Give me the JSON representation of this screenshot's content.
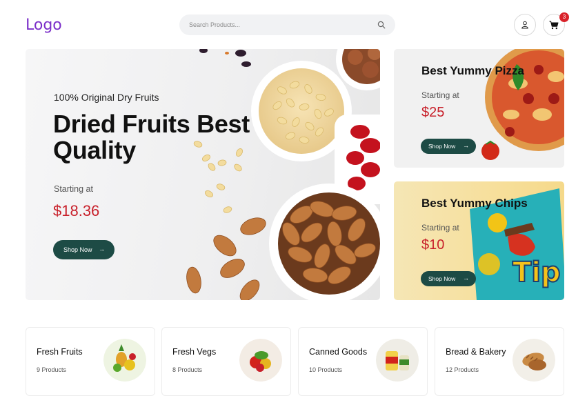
{
  "header": {
    "logo": "Logo",
    "search_placeholder": "Search Products...",
    "cart_count": "3"
  },
  "hero": {
    "subtitle": "100% Original Dry Fruits",
    "title": "Dried Fruits Best Quality",
    "starting_label": "Starting at",
    "price": "$18.36",
    "button": "Shop Now",
    "arrow": "→"
  },
  "promos": [
    {
      "title": "Best Yummy Pizza",
      "starting_label": "Starting at",
      "price": "$25",
      "button": "Shop Now",
      "arrow": "→"
    },
    {
      "title": "Best Yummy Chips",
      "starting_label": "Starting at",
      "price": "$10",
      "button": "Shop Now",
      "arrow": "→"
    }
  ],
  "categories": [
    {
      "name": "Fresh Fruits",
      "count": "9 Products",
      "color": "#eef4e2"
    },
    {
      "name": "Fresh Vegs",
      "count": "8 Products",
      "color": "#f3ece4"
    },
    {
      "name": "Canned Goods",
      "count": "10 Products",
      "color": "#efede6"
    },
    {
      "name": "Bread & Bakery",
      "count": "12 Products",
      "color": "#f2efe8"
    }
  ],
  "colors": {
    "brand": "#7b2fc9",
    "button": "#1d4b45",
    "price": "#c8202a",
    "badge": "#d9222a"
  }
}
